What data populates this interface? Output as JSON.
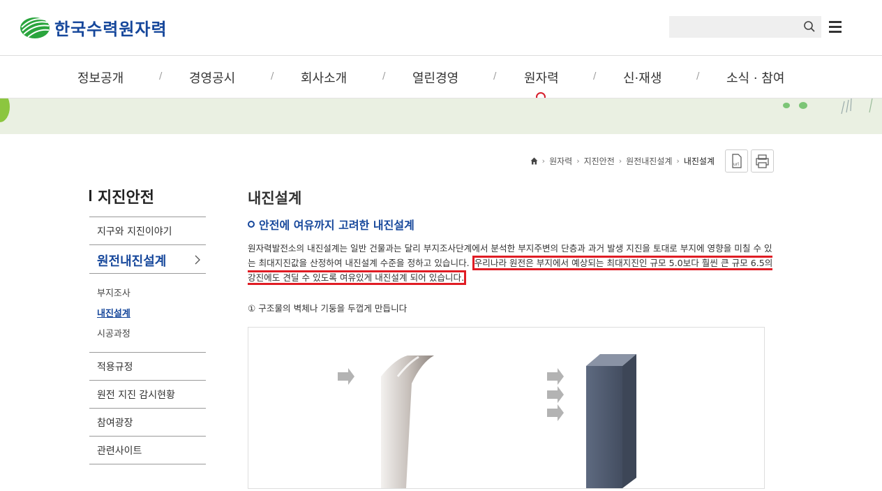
{
  "header": {
    "logo_text": "한국수력원자력",
    "search_placeholder": "",
    "brand_color": "#16479b"
  },
  "gnb": {
    "items": [
      "정보공개",
      "경영공시",
      "회사소개",
      "열린경영",
      "원자력",
      "신·재생",
      "소식 · 참여"
    ],
    "separator": "/",
    "active": "원자력",
    "active_color": "#d61f2c"
  },
  "breadcrumb": {
    "home_icon": "home-icon",
    "items": [
      "원자력",
      "지진안전",
      "원전내진설계",
      "내진설계"
    ],
    "tools": [
      "url-copy-icon",
      "print-icon"
    ]
  },
  "lnb": {
    "title": "지진안전",
    "items": [
      {
        "label": "지구와 지진이야기"
      },
      {
        "label": "원전내진설계",
        "active": true
      },
      {
        "label": "적용규정"
      },
      {
        "label": "원전 지진 감시현황"
      },
      {
        "label": "참여광장"
      },
      {
        "label": "관련사이트"
      }
    ],
    "sub_items": [
      {
        "label": "부지조사"
      },
      {
        "label": "내진설계",
        "active": true
      },
      {
        "label": "시공과정"
      }
    ]
  },
  "content": {
    "title": "내진설계",
    "subtitle": "안전에 여유까지 고려한 내진설계",
    "para_part1": "원자력발전소의 내진설계는 일반 건물과는 달리 부지조사단계에서 분석한 부지주변의 단층과 과거 발생 지진을 토대로 부지에 영향을 미칠 수 있는 최대지진값을 산정하여 내진설계 수준을 정하고 있습니다. ",
    "para_highlight": "우리나라 원전은 부지에서 예상되는 최대지진인 규모 5.0보다 훨씬 큰 규모 6.5의 강진에도 견딜 수 있도록 여유있게 내진설계 되어 있습니다.",
    "highlight_color": "#e01c24",
    "step1": "① 구조물의 벽체나 기둥을 두껍게 만듭니다"
  }
}
